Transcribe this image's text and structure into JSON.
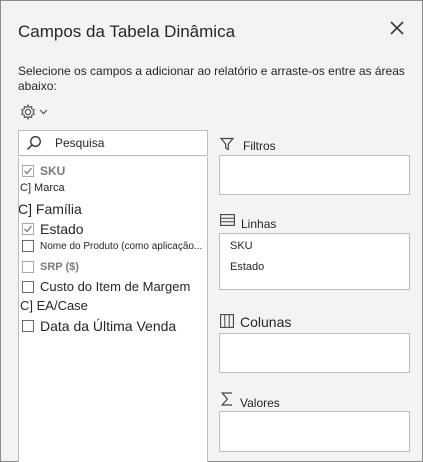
{
  "pane": {
    "title": "Campos da Tabela Dinâmica",
    "instructions": "Selecione os campos a adicionar ao relatório e arraste-os entre as áreas abaixo:"
  },
  "search": {
    "placeholder": "Pesquisa"
  },
  "fields": [
    {
      "label": "SKU",
      "checked": true
    },
    {
      "label": "C] Marca",
      "checked": null
    },
    {
      "label": "C] Família",
      "checked": null
    },
    {
      "label": "Estado",
      "checked": true
    },
    {
      "label": "Nome do Produto (como aplicação...",
      "checked": false
    },
    {
      "label": "SRP ($)",
      "checked": false
    },
    {
      "label": "Custo do Item de Margem",
      "checked": false
    },
    {
      "label": "C] EA/Case",
      "checked": null
    },
    {
      "label": "Data da Última Venda",
      "checked": false
    }
  ],
  "areas": {
    "filters": {
      "label": "Filtros",
      "items": []
    },
    "rows": {
      "label": "Linhas",
      "items": [
        "SKU",
        "Estado"
      ]
    },
    "columns": {
      "label": "Colunas",
      "items": []
    },
    "values": {
      "label": "Valores",
      "items": []
    }
  },
  "icons": {
    "close": "close-icon",
    "settings": "gear-icon",
    "search": "search-icon",
    "filter": "filter-icon",
    "rows": "rows-icon",
    "columns": "columns-icon",
    "values": "sigma-icon"
  }
}
